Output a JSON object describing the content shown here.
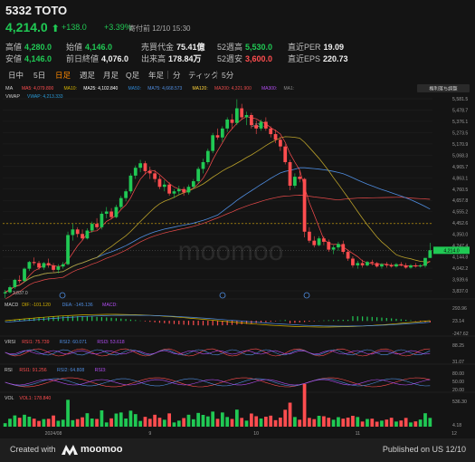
{
  "header": {
    "code": "5332",
    "name": "TOTO",
    "title": "5332 TOTO",
    "price": "4,214.0",
    "arrow": "⬆",
    "change": "+138.0",
    "change_pct": "+3.39%",
    "session": "寄付前 12/10 15:30"
  },
  "stats": {
    "high_label": "高値",
    "high": "4,280.0",
    "low_label": "安値",
    "low": "4,146.0",
    "open_label": "始値",
    "open": "4,146.0",
    "prev_label": "前日終値",
    "prev": "4,076.0",
    "turnover_label": "売買代金",
    "turnover": "75.41億",
    "volume_label": "出来高",
    "volume": "178.84万",
    "w52h_label": "52週高",
    "w52h": "5,530.0",
    "w52l_label": "52週安",
    "w52l": "3,600.0",
    "per_label": "直近PER",
    "per": "19.09",
    "eps_label": "直近EPS",
    "eps": "220.73"
  },
  "tabs": [
    "日中",
    "5日",
    "日足",
    "週足",
    "月足",
    "Q足",
    "年足",
    "分",
    "ティック",
    "5分"
  ],
  "active_tab": "日足",
  "colors": {
    "up": "#20c954",
    "down": "#ff4d4f",
    "accent": "#ff8a00",
    "ma5": "#ff4d4f",
    "ma10": "#d4b200",
    "ma25": "#ffffff",
    "ma50": "#2f88d6",
    "ma75": "#4f8de0",
    "ma120": "#ffd43b",
    "ma200": "#e84a4a",
    "ma300": "#b24cf2",
    "vwap": "#2a9bd8"
  },
  "indicators": {
    "ma_row": {
      "name": "MA",
      "items": [
        {
          "label": "MA5:",
          "value": "4,079.800",
          "color": "#ff4d4f"
        },
        {
          "label": "MA10:",
          "value": "",
          "color": "#d4b200"
        },
        {
          "label": "MA25:",
          "value": "4,102.840",
          "color": "#ffffff"
        },
        {
          "label": "MA50:",
          "value": "",
          "color": "#2f88d6"
        },
        {
          "label": "MA75:",
          "value": "4,668.573",
          "color": "#4f8de0"
        },
        {
          "label": "MA120:",
          "value": "",
          "color": "#ffd43b"
        },
        {
          "label": "MA200:",
          "value": "4,321.900",
          "color": "#e84a4a"
        },
        {
          "label": "MA300:",
          "value": "",
          "color": "#b24cf2"
        },
        {
          "label": "MA1:",
          "value": "",
          "color": "#888888"
        }
      ],
      "adjust": "権利落ち調整"
    },
    "vwap_row": {
      "name": "VWAP",
      "label": "VWAP:",
      "value": "4,213.333"
    },
    "macd": {
      "name": "MACD",
      "dif": "DIF: -101.120",
      "dea": "DEA: -145.136",
      "macd": "MACD:"
    },
    "vrsi": {
      "name": "VRSI",
      "r1": "RSI1: 75.739",
      "r2": "RSI2: 60.071",
      "r3": "RSI3: 53.618"
    },
    "rsi": {
      "name": "RSI",
      "r1": "RSI1: 91.256",
      "r2": "RSI2: 64.808",
      "r3": "RSI3:"
    },
    "vol": {
      "name": "VOL",
      "v": "VOL1: 178.840"
    }
  },
  "chart_data": {
    "type": "candlestick",
    "price_axis": [
      "5,581.5",
      "5,478.7",
      "5,376.1",
      "5,273.5",
      "5,170.9",
      "5,068.3",
      "4,965.7",
      "4,863.1",
      "4,760.5",
      "4,657.8",
      "4,555.2",
      "4,452.6",
      "4,350.0",
      "4,247.4",
      "4,144.8",
      "4,042.2",
      "3,939.6",
      "3,837.0"
    ],
    "price_range": [
      3837,
      5581.5
    ],
    "current_price": "4,214.0",
    "hi_marker": "5,530.0",
    "lo_marker": "3,837.0",
    "ref_line": 4452.6,
    "x_labels": [
      "2024/08",
      "9",
      "10",
      "11",
      "12"
    ],
    "x_label_index": [
      10,
      30,
      52,
      73,
      93
    ],
    "candles": [
      [
        3830,
        3860,
        3790,
        3840
      ],
      [
        3840,
        3900,
        3830,
        3885
      ],
      [
        3885,
        3960,
        3870,
        3950
      ],
      [
        3950,
        3990,
        3920,
        3940
      ],
      [
        3940,
        4060,
        3930,
        4050
      ],
      [
        4050,
        4120,
        4030,
        4110
      ],
      [
        4110,
        4150,
        4080,
        4100
      ],
      [
        4100,
        4120,
        4040,
        4060
      ],
      [
        4060,
        4110,
        4040,
        4100
      ],
      [
        4100,
        4140,
        4060,
        4080
      ],
      [
        4080,
        4100,
        4020,
        4040
      ],
      [
        4040,
        4090,
        4010,
        4070
      ],
      [
        4070,
        4110,
        4050,
        4090
      ],
      [
        4090,
        4380,
        4080,
        4350
      ],
      [
        4350,
        4450,
        4300,
        4400
      ],
      [
        4400,
        4420,
        4330,
        4360
      ],
      [
        4360,
        4400,
        4300,
        4320
      ],
      [
        4320,
        4410,
        4310,
        4390
      ],
      [
        4390,
        4470,
        4370,
        4450
      ],
      [
        4450,
        4500,
        4400,
        4420
      ],
      [
        4420,
        4560,
        4400,
        4540
      ],
      [
        4540,
        4600,
        4500,
        4560
      ],
      [
        4560,
        4590,
        4490,
        4510
      ],
      [
        4510,
        4620,
        4500,
        4600
      ],
      [
        4600,
        4700,
        4580,
        4680
      ],
      [
        4680,
        4760,
        4650,
        4740
      ],
      [
        4740,
        4900,
        4720,
        4880
      ],
      [
        4880,
        4970,
        4850,
        4950
      ],
      [
        4950,
        5020,
        4910,
        4990
      ],
      [
        4990,
        5010,
        4890,
        4920
      ],
      [
        4920,
        4960,
        4850,
        4900
      ],
      [
        4900,
        4930,
        4820,
        4850
      ],
      [
        4850,
        4880,
        4760,
        4780
      ],
      [
        4780,
        4840,
        4740,
        4800
      ],
      [
        4800,
        4820,
        4700,
        4720
      ],
      [
        4720,
        4760,
        4680,
        4740
      ],
      [
        4740,
        4790,
        4710,
        4760
      ],
      [
        4760,
        4780,
        4700,
        4730
      ],
      [
        4730,
        4800,
        4710,
        4780
      ],
      [
        4780,
        4850,
        4760,
        4830
      ],
      [
        4830,
        4960,
        4810,
        4940
      ],
      [
        4940,
        5030,
        4900,
        5000
      ],
      [
        5000,
        5120,
        4980,
        5100
      ],
      [
        5100,
        5260,
        5080,
        5240
      ],
      [
        5240,
        5300,
        5200,
        5220
      ],
      [
        5220,
        5320,
        5180,
        5300
      ],
      [
        5300,
        5400,
        5270,
        5380
      ],
      [
        5380,
        5430,
        5300,
        5350
      ],
      [
        5350,
        5560,
        5330,
        5480
      ],
      [
        5480,
        5520,
        5380,
        5400
      ],
      [
        5400,
        5450,
        5330,
        5420
      ],
      [
        5420,
        5440,
        5300,
        5330
      ],
      [
        5330,
        5370,
        5250,
        5300
      ],
      [
        5300,
        5380,
        5280,
        5360
      ],
      [
        5360,
        5400,
        5280,
        5300
      ],
      [
        5300,
        5320,
        5220,
        5250
      ],
      [
        5250,
        5290,
        5170,
        5200
      ],
      [
        5200,
        5230,
        5100,
        5140
      ],
      [
        5140,
        5160,
        4980,
        5000
      ],
      [
        5000,
        5020,
        4750,
        4790
      ],
      [
        4790,
        4900,
        4770,
        4870
      ],
      [
        4870,
        4920,
        4820,
        4850
      ],
      [
        4850,
        4860,
        4330,
        4380
      ],
      [
        4380,
        4420,
        4280,
        4300
      ],
      [
        4300,
        4340,
        4240,
        4260
      ],
      [
        4260,
        4340,
        4250,
        4320
      ],
      [
        4320,
        4340,
        4260,
        4290
      ],
      [
        4290,
        4310,
        4200,
        4220
      ],
      [
        4220,
        4260,
        4180,
        4240
      ],
      [
        4240,
        4290,
        4210,
        4270
      ],
      [
        4270,
        4300,
        4180,
        4200
      ],
      [
        4200,
        4220,
        4120,
        4140
      ],
      [
        4140,
        4160,
        4060,
        4080
      ],
      [
        4080,
        4120,
        4050,
        4100
      ],
      [
        4100,
        4130,
        4060,
        4080
      ],
      [
        4080,
        4120,
        4070,
        4110
      ],
      [
        4110,
        4130,
        4080,
        4100
      ],
      [
        4100,
        4110,
        4060,
        4070
      ],
      [
        4070,
        4100,
        4050,
        4090
      ],
      [
        4090,
        4110,
        4060,
        4080
      ],
      [
        4080,
        4100,
        4060,
        4070
      ],
      [
        4070,
        4100,
        4060,
        4090
      ],
      [
        4090,
        4110,
        4070,
        4080
      ],
      [
        4080,
        4100,
        4050,
        4060
      ],
      [
        4060,
        4090,
        4050,
        4080
      ],
      [
        4080,
        4100,
        4060,
        4070
      ],
      [
        4070,
        4090,
        4060,
        4080
      ],
      [
        4076,
        4146,
        4060,
        4146
      ],
      [
        4146,
        4280,
        4146,
        4214
      ]
    ],
    "macd_axis": [
      "293.96",
      "23.14",
      "-247.62"
    ],
    "vrsi_axis": [
      "88.25",
      "31.07"
    ],
    "rsi_axis": [
      "80.00",
      "50.00",
      "20.00"
    ],
    "vol_axis": [
      "536.30",
      "4.18"
    ]
  },
  "footer": {
    "created": "Created with",
    "brand": "moomoo",
    "published": "Published on US 12/10"
  }
}
